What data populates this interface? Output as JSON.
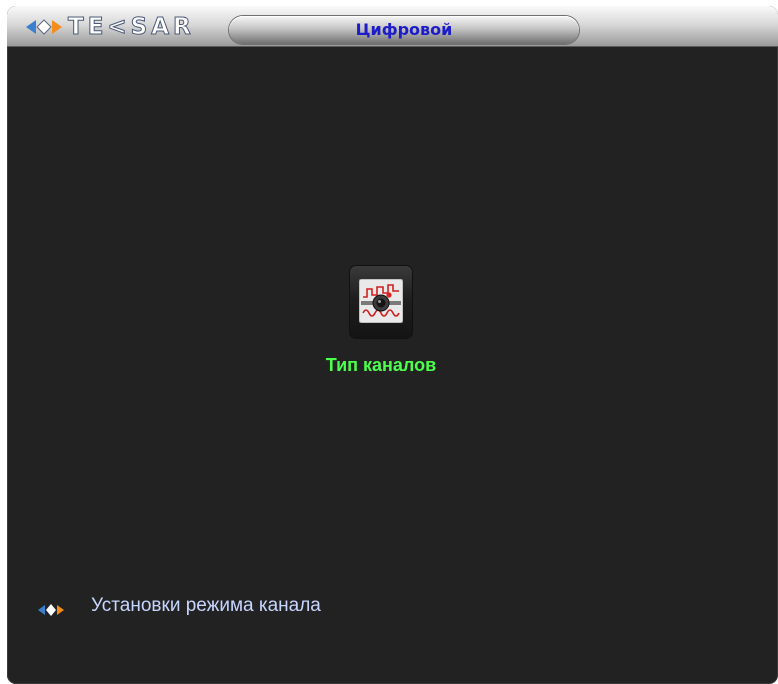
{
  "window": {
    "brand": "TE<SAR",
    "title": "Цифровой"
  },
  "main": {
    "icon": "channel-type-icon",
    "label": "Тип каналов"
  },
  "footer": {
    "icon": "diamond-arrows-icon",
    "hint": "Установки режима канала"
  },
  "colors": {
    "background": "#222222",
    "title_text": "#1c1cc8",
    "label_green": "#4cff4c",
    "hint_text": "#c7d6ff"
  }
}
